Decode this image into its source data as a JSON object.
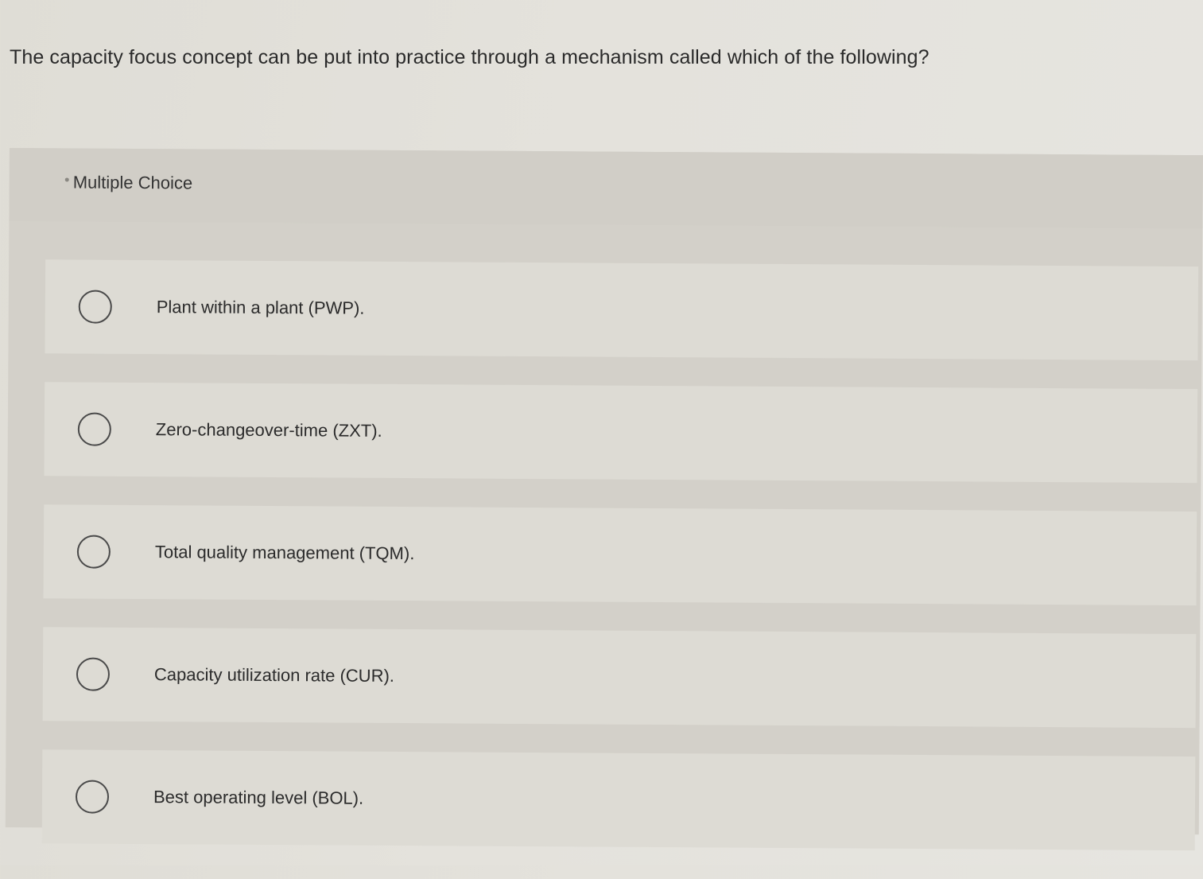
{
  "question": {
    "text": "The capacity focus concept can be put into practice through a mechanism called which of the following?"
  },
  "question_type": {
    "label": "Multiple Choice"
  },
  "choices": [
    {
      "label": "Plant within a plant (PWP).",
      "selected": false
    },
    {
      "label": "Zero-changeover-time (ZXT).",
      "selected": false
    },
    {
      "label": "Total quality management (TQM).",
      "selected": false
    },
    {
      "label": "Capacity utilization rate (CUR).",
      "selected": false
    },
    {
      "label": "Best operating level (BOL).",
      "selected": false
    }
  ],
  "colors": {
    "background": "#e2e0da",
    "panel": "#d3d0c9",
    "choice_row": "#dddbd4",
    "text": "#2b2b2b",
    "radio_border": "#4a4a4a"
  },
  "icons": {
    "radio": "radio-unchecked-icon",
    "bullet": "bullet-dot-icon"
  }
}
